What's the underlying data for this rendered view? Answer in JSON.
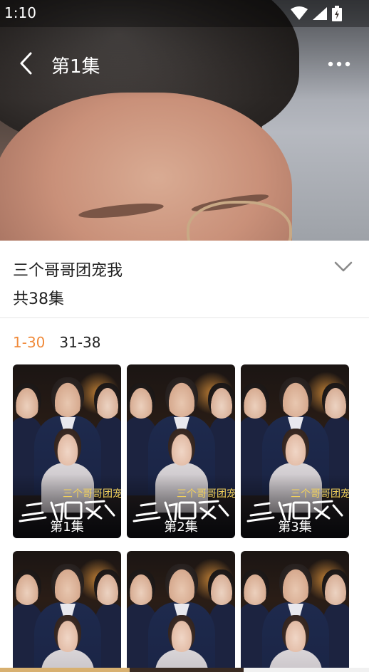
{
  "status_bar": {
    "time": "1:10",
    "icons": [
      "wifi-icon",
      "cell-signal-icon",
      "battery-charging-icon"
    ]
  },
  "player": {
    "episode_title": "第1集",
    "back_icon": "chevron-left-icon",
    "more_icon": "more-horizontal-icon"
  },
  "drama": {
    "title": "三个哥哥团宠我",
    "episode_count": "共38集",
    "expand_icon": "chevron-down-icon"
  },
  "range_tabs": [
    {
      "label": "1-30",
      "active": true
    },
    {
      "label": "31-38",
      "active": false
    }
  ],
  "episodes": [
    {
      "label": "第1集",
      "logo_text": "三个哥哥团宠我"
    },
    {
      "label": "第2集",
      "logo_text": "三个哥哥团宠我"
    },
    {
      "label": "第3集",
      "logo_text": "三个哥哥团宠我"
    },
    {
      "label": "",
      "logo_text": ""
    },
    {
      "label": "",
      "logo_text": ""
    },
    {
      "label": "",
      "logo_text": ""
    }
  ],
  "colors": {
    "accent": "#f08a3a",
    "text_primary": "#222222",
    "divider": "#e6e6e6"
  }
}
